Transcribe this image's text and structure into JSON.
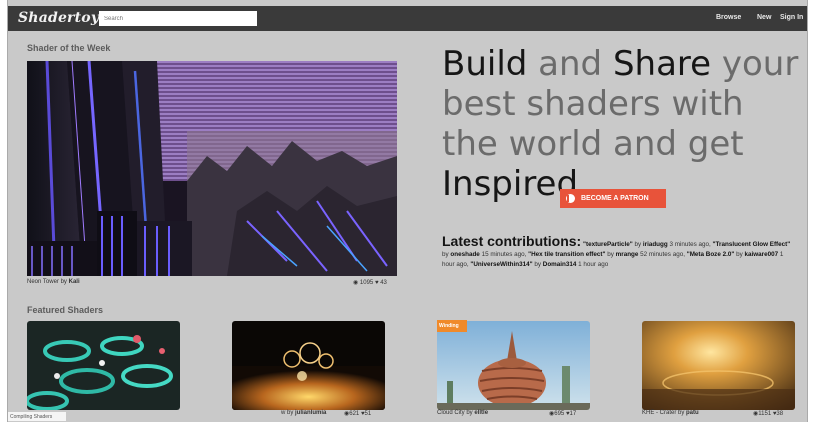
{
  "topbar": {
    "logo": "Shadertoy",
    "search_placeholder": "Search",
    "nav": [
      "Browse",
      "New",
      "Sign In"
    ]
  },
  "shader_of_week": {
    "section_title": "Shader of the Week",
    "caption_name": "Neon Tower",
    "caption_by": "by",
    "caption_author": "Kali",
    "views": "1095",
    "likes": "43"
  },
  "hero": {
    "w1": "Build",
    "w2": " and ",
    "w3": "Share",
    "w4": " your best shaders with the world and get ",
    "w5": "Inspired"
  },
  "patron_button": "BECOME A PATRON",
  "latest": {
    "title": "Latest contributions:",
    "items": [
      {
        "name": "\"textureParticle\"",
        "by": "by",
        "author": "iriadugg",
        "time": "3 minutes ago,"
      },
      {
        "name": "\"Translucent Glow Effect\"",
        "by": "by",
        "author": "oneshade",
        "time": "15 minutes ago,"
      },
      {
        "name": "\"Hex tile transition effect\"",
        "by": "by",
        "author": "mrange",
        "time": "52 minutes ago,"
      },
      {
        "name": "\"Meta Boze 2.0\"",
        "by": "by",
        "author": "kaiware007",
        "time": "1 hour ago,"
      },
      {
        "name": "\"UniverseWithin314\"",
        "by": "by",
        "author": "Domain314",
        "time": "1 hour ago"
      }
    ]
  },
  "featured": {
    "section_title": "Featured Shaders",
    "items": [
      {
        "caption": "",
        "author": "",
        "views": "",
        "likes": ""
      },
      {
        "caption": "w by",
        "author": "julianlumia",
        "views": "621",
        "likes": "51"
      },
      {
        "caption": "Cloud City by",
        "author": "elltle",
        "views": "695",
        "likes": "17",
        "badge": "Winding"
      },
      {
        "caption": "KHE - Crater by",
        "author": "patu",
        "views": "1151",
        "likes": "38"
      }
    ]
  },
  "status_strip": "Compiling Shaders",
  "colors": {
    "topbar": "#3a3a3a",
    "page_bg": "#c9c9c9",
    "patron": "#e8533a",
    "badge": "#f08a2a"
  }
}
